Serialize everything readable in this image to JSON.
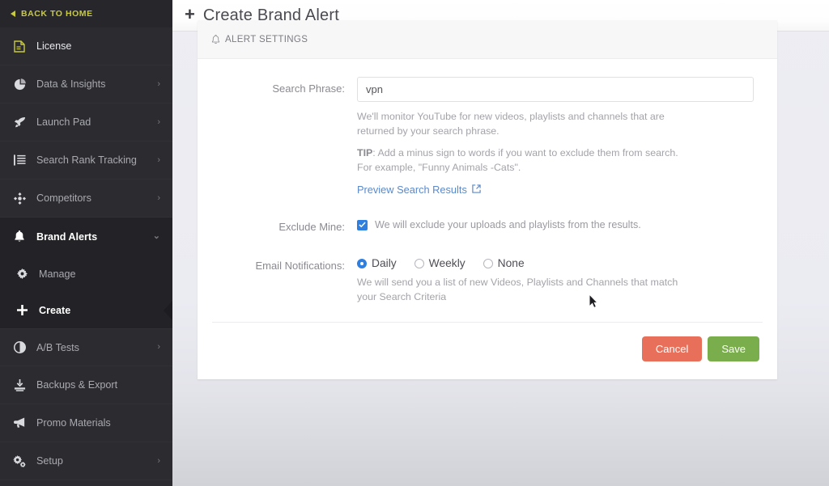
{
  "sidebar": {
    "back_home": {
      "label": "BACK TO HOME",
      "icon": "triangle-left-icon",
      "color": "#c9ca3e"
    },
    "items": [
      {
        "label": "License",
        "icon": "license-document-icon",
        "chevron": ""
      },
      {
        "label": "Data & Insights",
        "icon": "pie-chart-icon",
        "chevron": "›"
      },
      {
        "label": "Launch Pad",
        "icon": "rocket-icon",
        "chevron": "›"
      },
      {
        "label": "Search Rank Tracking",
        "icon": "list-icon",
        "chevron": "›"
      },
      {
        "label": "Competitors",
        "icon": "diamond-icon",
        "chevron": "›"
      }
    ],
    "group": {
      "label": "Brand Alerts",
      "icon": "bell-icon",
      "chevron": "⌄",
      "children": [
        {
          "label": "Manage",
          "icon": "gear-icon",
          "active": false
        },
        {
          "label": "Create",
          "icon": "plus-icon",
          "active": true
        }
      ]
    },
    "items_after": [
      {
        "label": "A/B Tests",
        "icon": "contrast-circle-icon",
        "chevron": "›"
      },
      {
        "label": "Backups & Export",
        "icon": "download-icon",
        "chevron": ""
      },
      {
        "label": "Promo Materials",
        "icon": "megaphone-icon",
        "chevron": ""
      },
      {
        "label": "Setup",
        "icon": "gears-icon",
        "chevron": "›"
      }
    ]
  },
  "topbar": {
    "icon": "plus-icon",
    "title": "Create Brand Alert"
  },
  "card": {
    "header": {
      "icon": "bell-icon",
      "title": "ALERT SETTINGS"
    },
    "search_phrase": {
      "label": "Search Phrase:",
      "value": "vpn",
      "placeholder": "",
      "help_1": "We'll monitor YouTube for new videos, playlists and channels that are returned by your search phrase.",
      "tip_label": "TIP",
      "tip_text": ": Add a minus sign to words if you want to exclude them from search. For example, \"Funny Animals -Cats\".",
      "preview_link": "Preview Search Results",
      "preview_icon": "external-link-icon"
    },
    "exclude_mine": {
      "label": "Exclude Mine:",
      "checked": true,
      "text": "We will exclude your uploads and playlists from the results."
    },
    "email_notifications": {
      "label": "Email Notifications:",
      "options": [
        {
          "label": "Daily",
          "selected": true
        },
        {
          "label": "Weekly",
          "selected": false
        },
        {
          "label": "None",
          "selected": false
        }
      ],
      "help": "We will send you a list of new Videos, Playlists and Channels that match your Search Criteria"
    },
    "actions": {
      "cancel_label": "Cancel",
      "save_label": "Save",
      "cancel_color": "#e8705a",
      "save_color": "#7aad4c"
    }
  },
  "colors": {
    "sidebar_bg": "#2b2b30",
    "sidebar_group_bg": "#232327",
    "accent_yellow": "#c9ca3e",
    "accent_blue": "#2e7fe0",
    "link_blue": "#5b89c9"
  }
}
